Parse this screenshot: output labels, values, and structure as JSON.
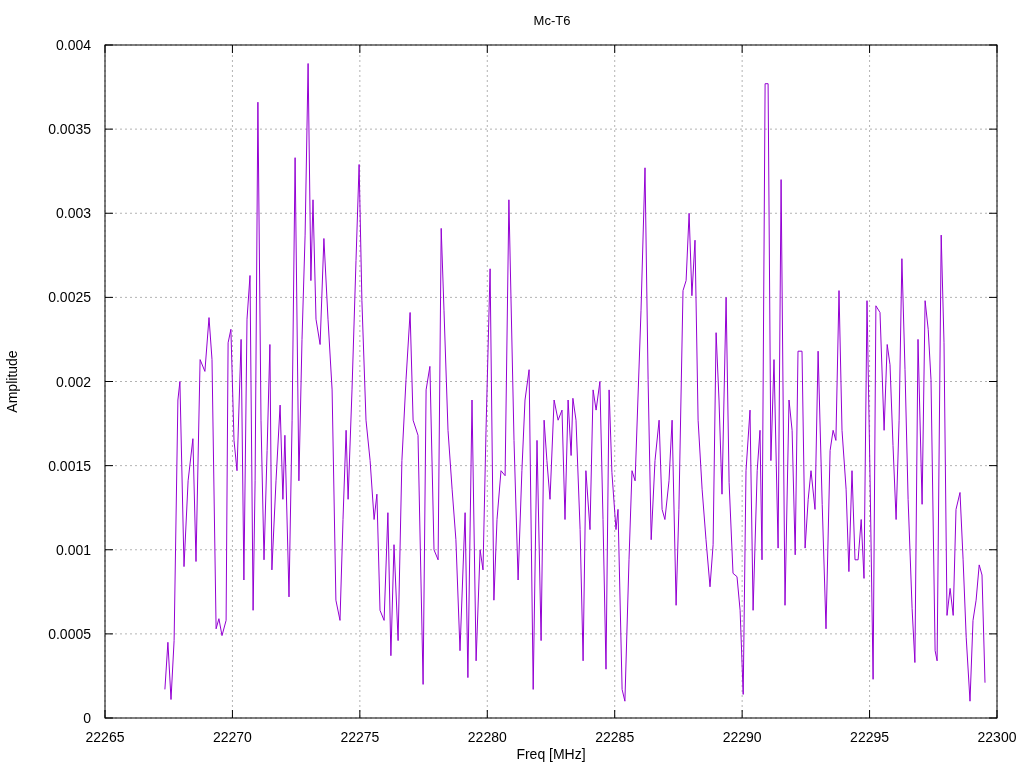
{
  "chart_data": {
    "type": "line",
    "grid": true,
    "title": "Mc-T6",
    "xlabel": "Freq [MHz]",
    "ylabel": "Amplitude",
    "xlim": [
      22265,
      22300
    ],
    "ylim": [
      0,
      0.004
    ],
    "xticks": [
      22265,
      22270,
      22275,
      22280,
      22285,
      22290,
      22295,
      22300
    ],
    "yticks": [
      0,
      0.0005,
      0.001,
      0.0015,
      0.002,
      0.0025,
      0.003,
      0.0035,
      0.004
    ],
    "x": [
      22267.35,
      22267.47,
      22267.59,
      22267.71,
      22267.86,
      22267.94,
      22268.1,
      22268.26,
      22268.45,
      22268.57,
      22268.73,
      22268.92,
      22269.08,
      22269.2,
      22269.36,
      22269.47,
      22269.59,
      22269.75,
      22269.83,
      22269.94,
      22270.06,
      22270.18,
      22270.34,
      22270.45,
      22270.57,
      22270.69,
      22270.81,
      22270.89,
      22271.0,
      22271.12,
      22271.24,
      22271.36,
      22271.47,
      22271.55,
      22271.71,
      22271.87,
      22271.98,
      22272.06,
      22272.22,
      22272.34,
      22272.46,
      22272.61,
      22272.73,
      22272.85,
      22272.97,
      22273.08,
      22273.16,
      22273.28,
      22273.44,
      22273.59,
      22273.75,
      22273.91,
      22274.06,
      22274.22,
      22274.34,
      22274.46,
      22274.54,
      22274.69,
      22274.85,
      22274.97,
      22275.08,
      22275.24,
      22275.4,
      22275.56,
      22275.67,
      22275.79,
      22275.95,
      22276.1,
      22276.22,
      22276.34,
      22276.5,
      22276.65,
      22276.81,
      22276.97,
      22277.09,
      22277.28,
      22277.48,
      22277.6,
      22277.75,
      22277.91,
      22278.07,
      22278.19,
      22278.3,
      22278.46,
      22278.62,
      22278.77,
      22278.93,
      22279.13,
      22279.24,
      22279.4,
      22279.56,
      22279.72,
      22279.83,
      22279.95,
      22280.11,
      22280.26,
      22280.38,
      22280.54,
      22280.7,
      22280.85,
      22281.05,
      22281.21,
      22281.36,
      22281.48,
      22281.64,
      22281.8,
      22281.95,
      22282.11,
      22282.23,
      22282.34,
      22282.46,
      22282.62,
      22282.78,
      22282.93,
      22283.05,
      22283.17,
      22283.29,
      22283.36,
      22283.48,
      22283.64,
      22283.76,
      22283.87,
      22284.03,
      22284.15,
      22284.27,
      22284.42,
      22284.54,
      22284.66,
      22284.78,
      22284.89,
      22285.05,
      22285.13,
      22285.29,
      22285.4,
      22285.56,
      22285.68,
      22285.8,
      22285.91,
      22286.03,
      22286.19,
      22286.31,
      22286.43,
      22286.58,
      22286.74,
      22286.86,
      22286.97,
      22287.13,
      22287.25,
      22287.41,
      22287.52,
      22287.68,
      22287.8,
      22287.92,
      22288.03,
      22288.15,
      22288.27,
      22288.43,
      22288.58,
      22288.74,
      22288.86,
      22288.98,
      22289.09,
      22289.21,
      22289.37,
      22289.49,
      22289.64,
      22289.8,
      22289.92,
      22290.04,
      22290.15,
      22290.31,
      22290.43,
      22290.59,
      22290.7,
      22290.78,
      22290.9,
      22291.02,
      22291.13,
      22291.25,
      22291.41,
      22291.53,
      22291.68,
      22291.84,
      22291.96,
      22292.08,
      22292.19,
      22292.35,
      22292.47,
      22292.59,
      22292.7,
      22292.86,
      22292.98,
      22293.14,
      22293.29,
      22293.45,
      22293.57,
      22293.68,
      22293.8,
      22293.92,
      22294.08,
      22294.19,
      22294.31,
      22294.43,
      22294.55,
      22294.67,
      22294.78,
      22294.9,
      22295.02,
      22295.14,
      22295.25,
      22295.41,
      22295.57,
      22295.69,
      22295.8,
      22295.92,
      22296.04,
      22296.16,
      22296.27,
      22296.39,
      22296.51,
      22296.67,
      22296.78,
      22296.9,
      22297.06,
      22297.18,
      22297.3,
      22297.41,
      22297.57,
      22297.65,
      22297.81,
      22297.92,
      22298.04,
      22298.16,
      22298.28,
      22298.39,
      22298.55,
      22298.67,
      22298.79,
      22298.94,
      22299.06,
      22299.18,
      22299.3,
      22299.41,
      22299.53
    ],
    "series": [
      {
        "color": "#9400d3",
        "values": [
          0.00017,
          0.00045,
          0.00011,
          0.00046,
          0.00189,
          0.002,
          0.0009,
          0.00141,
          0.00166,
          0.00093,
          0.00213,
          0.00206,
          0.00238,
          0.00213,
          0.00053,
          0.00059,
          0.00049,
          0.00058,
          0.00223,
          0.00231,
          0.00165,
          0.00147,
          0.00225,
          0.00082,
          0.00237,
          0.00263,
          0.00064,
          0.00141,
          0.00366,
          0.00177,
          0.00094,
          0.00159,
          0.00222,
          0.00088,
          0.00141,
          0.00186,
          0.0013,
          0.00168,
          0.00072,
          0.00177,
          0.00333,
          0.00141,
          0.00225,
          0.00287,
          0.00389,
          0.0026,
          0.00308,
          0.00237,
          0.00222,
          0.00285,
          0.00237,
          0.00195,
          0.0007,
          0.00058,
          0.00118,
          0.00171,
          0.0013,
          0.00195,
          0.00272,
          0.00329,
          0.00248,
          0.00177,
          0.00153,
          0.00118,
          0.00133,
          0.00064,
          0.00058,
          0.00122,
          0.00037,
          0.00103,
          0.00046,
          0.00153,
          0.00201,
          0.00241,
          0.00177,
          0.00168,
          0.0002,
          0.00195,
          0.00209,
          0.001,
          0.00094,
          0.00291,
          0.00242,
          0.00171,
          0.00136,
          0.00106,
          0.0004,
          0.00122,
          0.00024,
          0.00189,
          0.00034,
          0.001,
          0.00088,
          0.00171,
          0.00267,
          0.0007,
          0.00118,
          0.00147,
          0.00144,
          0.00308,
          0.00165,
          0.00082,
          0.00147,
          0.00189,
          0.00207,
          0.00017,
          0.00165,
          0.00046,
          0.00177,
          0.00153,
          0.0013,
          0.00189,
          0.00177,
          0.00183,
          0.00118,
          0.00189,
          0.00156,
          0.0019,
          0.00177,
          0.00112,
          0.00034,
          0.00147,
          0.00112,
          0.00195,
          0.00183,
          0.002,
          0.00118,
          0.00029,
          0.00195,
          0.00146,
          0.00112,
          0.00124,
          0.00017,
          0.0001,
          0.00094,
          0.00147,
          0.00141,
          0.00189,
          0.00242,
          0.00327,
          0.00201,
          0.00106,
          0.00153,
          0.00177,
          0.00124,
          0.00118,
          0.00141,
          0.00177,
          0.00067,
          0.00124,
          0.00254,
          0.0026,
          0.003,
          0.00251,
          0.00284,
          0.00177,
          0.00136,
          0.00106,
          0.00078,
          0.00103,
          0.00229,
          0.00189,
          0.00133,
          0.0025,
          0.0014,
          0.00086,
          0.00084,
          0.00064,
          0.00014,
          0.00147,
          0.00183,
          0.00064,
          0.00147,
          0.00171,
          0.00094,
          0.00377,
          0.00377,
          0.00153,
          0.00213,
          0.00101,
          0.0032,
          0.00067,
          0.00189,
          0.00171,
          0.00097,
          0.00218,
          0.00218,
          0.00101,
          0.0013,
          0.00147,
          0.00124,
          0.00218,
          0.00127,
          0.00053,
          0.00159,
          0.00171,
          0.00165,
          0.00254,
          0.00171,
          0.00136,
          0.00087,
          0.00147,
          0.00094,
          0.00094,
          0.00118,
          0.00083,
          0.00248,
          0.00141,
          0.00023,
          0.00245,
          0.00241,
          0.00171,
          0.00222,
          0.0021,
          0.00162,
          0.00118,
          0.00177,
          0.00273,
          0.00207,
          0.0013,
          0.00065,
          0.00033,
          0.00225,
          0.00127,
          0.00248,
          0.00231,
          0.00201,
          0.0004,
          0.00034,
          0.00287,
          0.00223,
          0.00061,
          0.00077,
          0.00061,
          0.00124,
          0.00134,
          0.00094,
          0.00048,
          0.0001,
          0.00058,
          0.0007,
          0.00091,
          0.00085,
          0.00021
        ]
      }
    ]
  }
}
